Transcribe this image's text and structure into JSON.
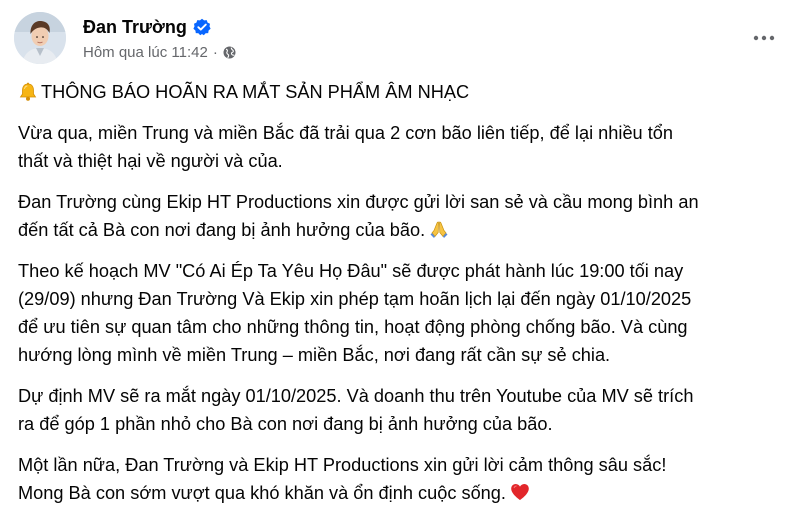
{
  "post": {
    "author": "Đan Trường",
    "timestamp": "Hôm qua lúc 11:42",
    "separator": "·",
    "audience_icon": "globe-icon",
    "verified_icon": "verified-badge-icon",
    "more_icon": "more-options-icon",
    "accent_color": "#0866ff",
    "meta_color": "#65676b",
    "title_icon": "bell-emoji",
    "title": "THÔNG BÁO HOÃN RA MẮT SẢN PHẨM ÂM NHẠC",
    "paragraphs": [
      {
        "lines": [
          "Vừa qua, miền Trung và miền Bắc đã trải qua 2 cơn bão liên tiếp, để lại nhiều tổn",
          "thất và thiệt hại về người và của."
        ]
      },
      {
        "lines": [
          "Đan Trường cùng Ekip HT Productions xin được gửi lời san sẻ và cầu mong bình an",
          "đến tất cả Bà con nơi đang bị ảnh hưởng của bão."
        ],
        "trailing_icon": "folded-hands-emoji"
      },
      {
        "lines": [
          "Theo kế hoạch MV \"Có Ai Ép Ta Yêu Họ Đâu\" sẽ được phát hành lúc 19:00 tối nay",
          "(29/09) nhưng Đan Trường Và Ekip xin phép tạm hoãn lịch lại đến ngày 01/10/2025",
          "để ưu tiên sự quan tâm cho những thông tin, hoạt động phòng chống bão. Và cùng",
          "hướng lòng mình về miền Trung – miền Bắc, nơi đang rất cần sự sẻ chia."
        ]
      },
      {
        "lines": [
          "Dự định MV sẽ ra mắt ngày 01/10/2025. Và doanh thu trên Youtube của MV sẽ trích",
          "ra để góp 1 phần nhỏ cho Bà con nơi đang bị ảnh hưởng của bão."
        ]
      },
      {
        "lines": [
          "Một lần nữa, Đan Trường và Ekip HT Productions xin gửi lời cảm thông sâu sắc!",
          "Mong Bà con sớm vượt qua khó khăn và ổn định cuộc sống."
        ],
        "trailing_icon": "red-heart-emoji"
      }
    ]
  }
}
